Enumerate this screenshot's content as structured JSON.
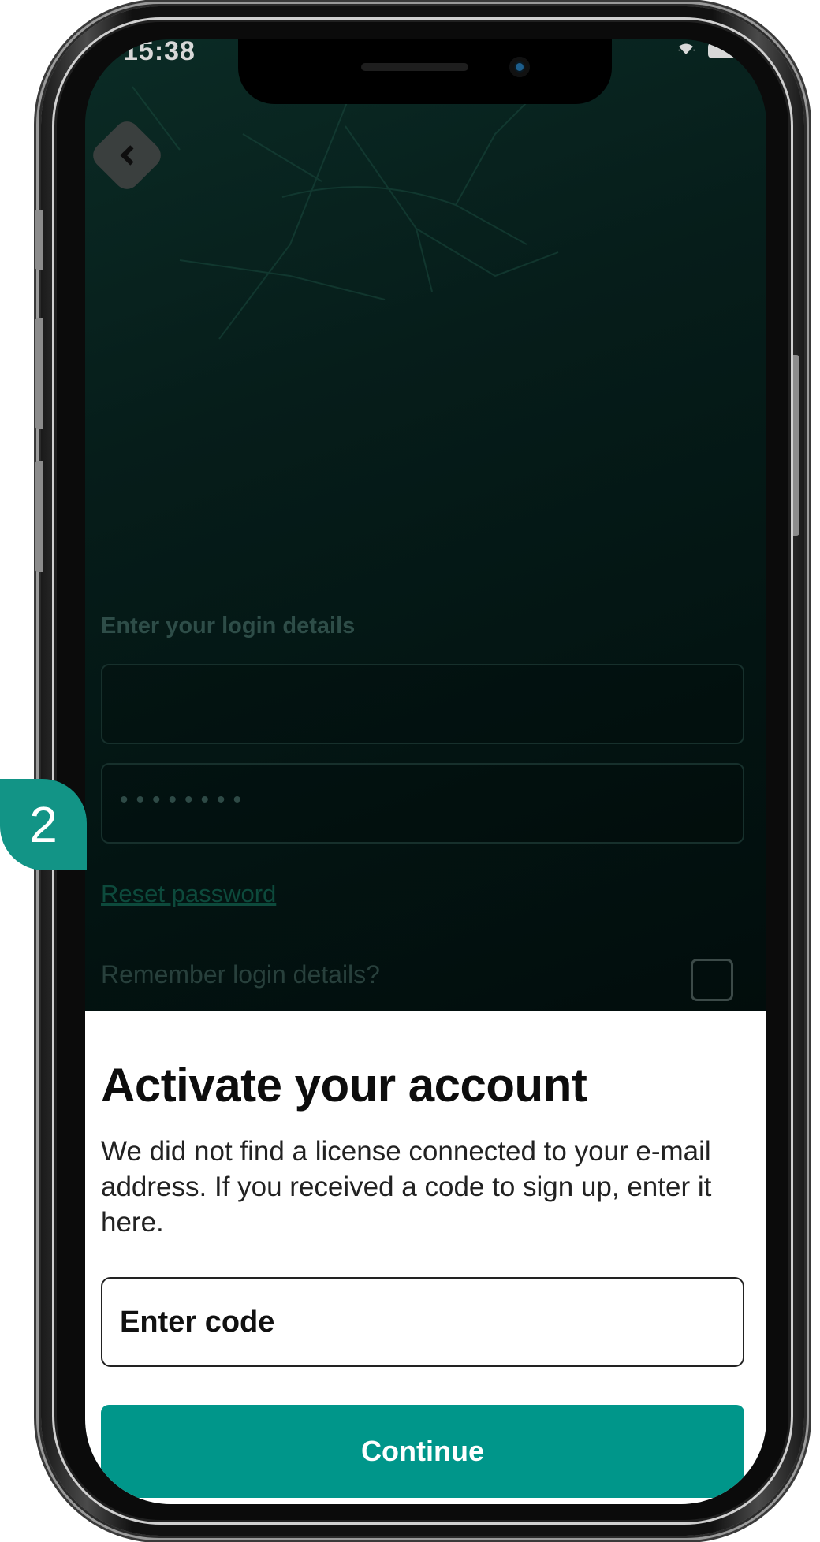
{
  "status_bar": {
    "time": "15:38",
    "signal_icon": "signal-icon",
    "wifi_icon": "wifi-icon",
    "battery_icon": "battery-icon"
  },
  "nav": {
    "back_icon": "chevron-left-icon"
  },
  "login": {
    "label": "Enter your login details",
    "username_value": "",
    "password_mask": "••••••••",
    "reset_link": "Reset password",
    "remember_label": "Remember login details?",
    "remember_checked": false
  },
  "sheet": {
    "title": "Activate your account",
    "body": "We did not find a license connected to your e-mail address. If you received a code to sign up, enter it here.",
    "code_placeholder": "Enter code",
    "continue_label": "Continue"
  },
  "step_badge": "2",
  "colors": {
    "accent": "#00968a",
    "badge": "#129486",
    "background_dark": "#051715"
  }
}
